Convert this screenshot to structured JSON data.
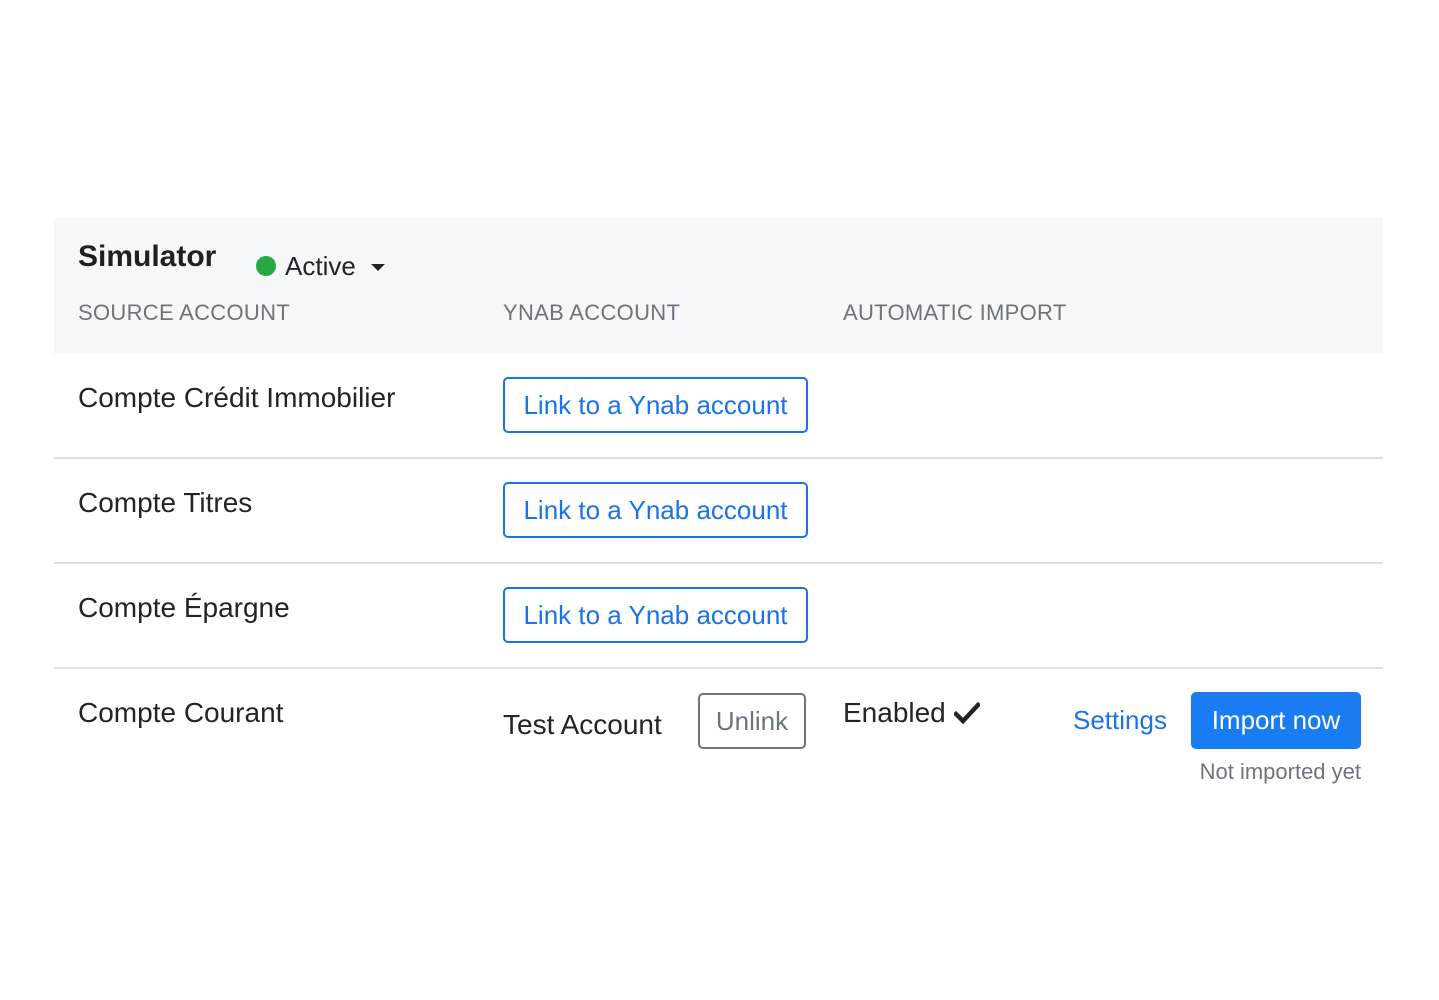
{
  "header": {
    "provider_name": "Simulator",
    "status_label": "Active",
    "status_color": "#28a745"
  },
  "columns": {
    "source": "SOURCE ACCOUNT",
    "ynab": "YNAB ACCOUNT",
    "auto_import": "AUTOMATIC IMPORT"
  },
  "rows": [
    {
      "source": "Compte Crédit Immobilier",
      "link_label": "Link to a Ynab account"
    },
    {
      "source": "Compte Titres",
      "link_label": "Link to a Ynab account"
    },
    {
      "source": "Compte Épargne",
      "link_label": "Link to a Ynab account"
    },
    {
      "source": "Compte Courant",
      "ynab_account": "Test Account",
      "unlink_label": "Unlink",
      "auto_import": "Enabled",
      "settings_label": "Settings",
      "import_label": "Import now",
      "last_import": "Not imported yet"
    }
  ],
  "colors": {
    "accent": "#1a73e8",
    "primary_button": "#1a7cf2",
    "header_bg": "#f6f7f8"
  },
  "icons": {
    "status": "green-dot-icon",
    "dropdown": "caret-down-icon",
    "enabled": "checkmark-icon"
  }
}
